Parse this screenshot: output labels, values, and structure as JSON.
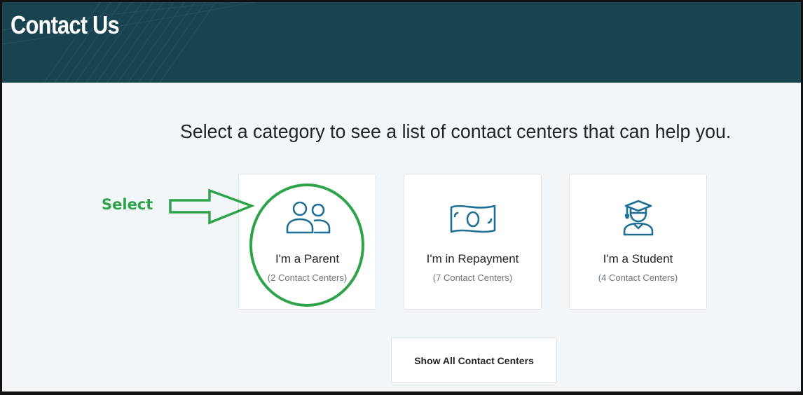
{
  "header": {
    "title": "Contact Us"
  },
  "main": {
    "prompt": "Select a category to see a list of contact centers that can help you.",
    "categories": [
      {
        "label": "I'm a Parent",
        "count": "(2 Contact Centers)",
        "icon": "parents-icon"
      },
      {
        "label": "I'm in Repayment",
        "count": "(7 Contact Centers)",
        "icon": "money-bill-icon"
      },
      {
        "label": "I'm a Student",
        "count": "(4 Contact Centers)",
        "icon": "graduate-icon"
      }
    ],
    "show_all_label": "Show All Contact Centers"
  },
  "annotation": {
    "label": "Select",
    "color": "#2ea34a"
  },
  "colors": {
    "header_bg": "#19434f",
    "icon": "#1d6f96",
    "page_bg": "#f3f6f9",
    "card_border": "#dfe3e7"
  }
}
